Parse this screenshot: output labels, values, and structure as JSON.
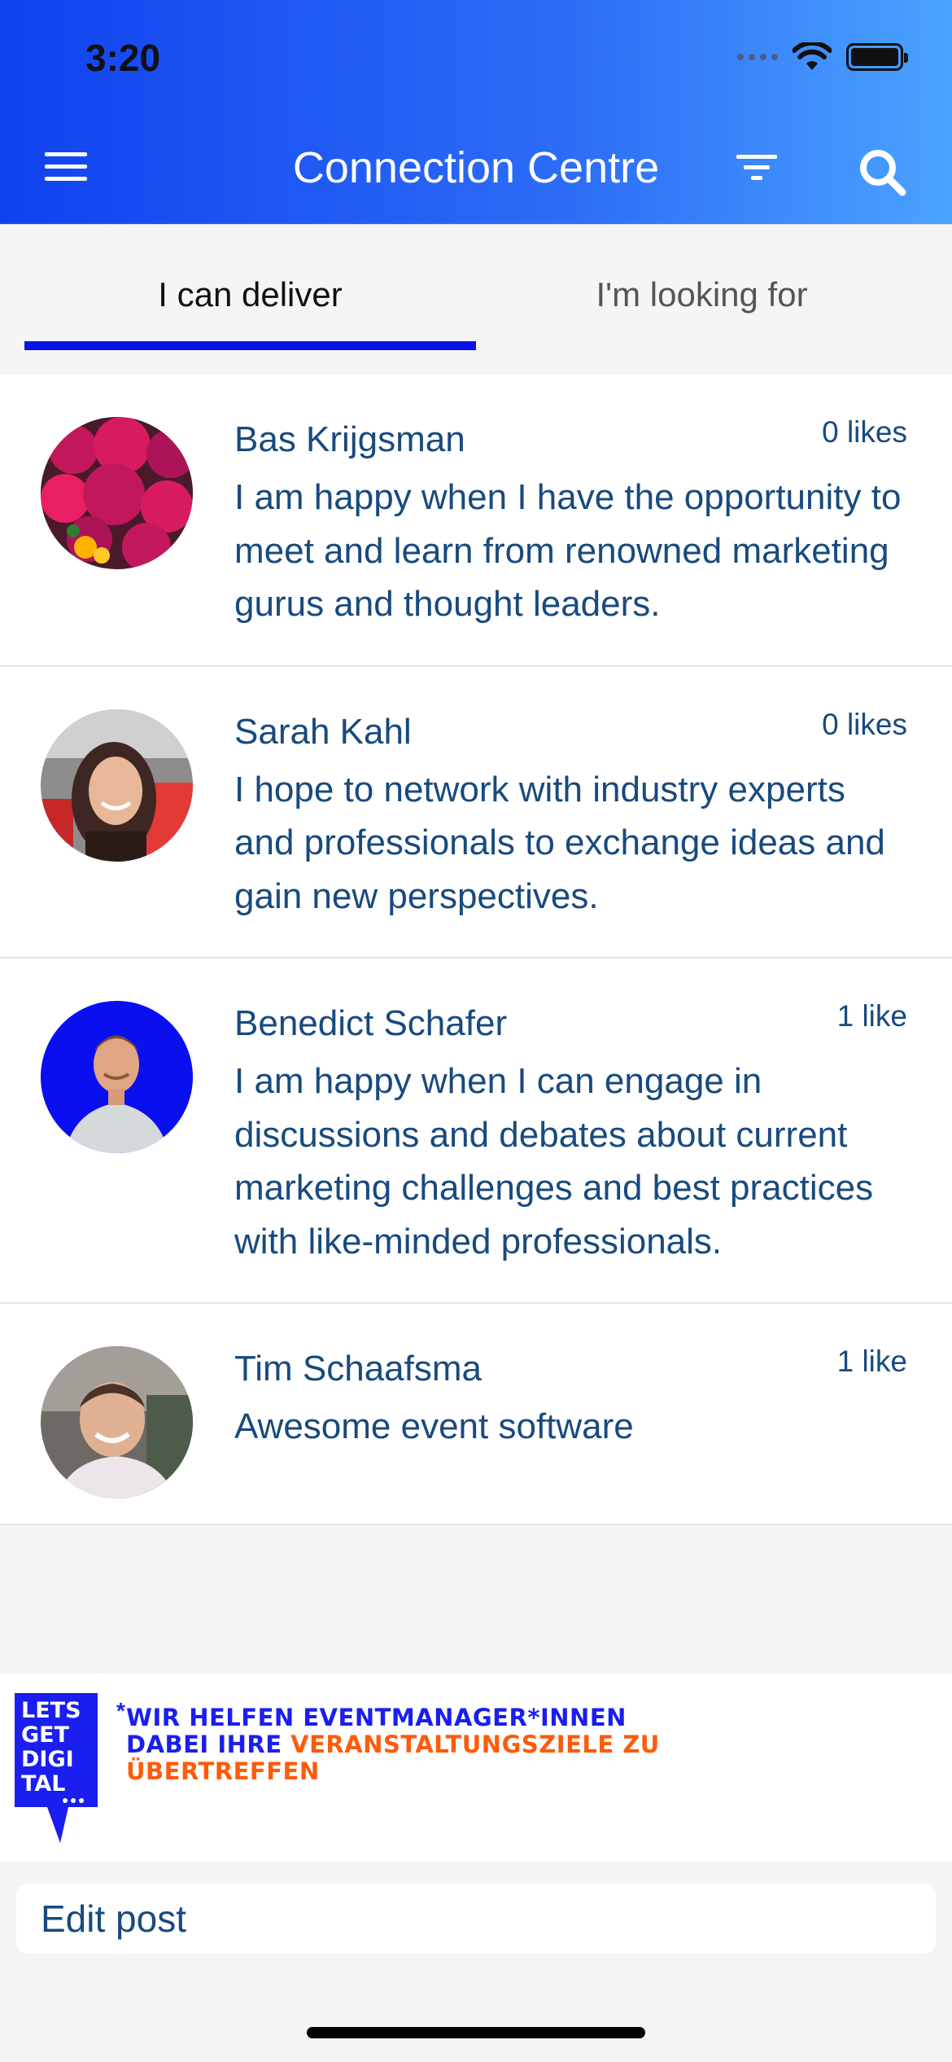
{
  "status_bar": {
    "time": "3:20"
  },
  "header": {
    "title": "Connection Centre"
  },
  "tabs": [
    {
      "label": "I can deliver"
    },
    {
      "label": "I'm looking for"
    }
  ],
  "posts": [
    {
      "name": "Bas Krijgsman",
      "likes": "0 likes",
      "text": "I am happy when I have the opportunity to meet and learn from renowned marketing gurus and thought leaders."
    },
    {
      "name": "Sarah Kahl",
      "likes": "0 likes",
      "text": "I hope to network with industry experts and professionals to exchange ideas and gain new perspectives."
    },
    {
      "name": "Benedict Schafer",
      "likes": "1 like",
      "text": "I am happy when I can engage in discussions and debates about current marketing challenges and best practices with like-minded professionals."
    },
    {
      "name": "Tim Schaafsma",
      "likes": "1 like",
      "text": "Awesome event software"
    }
  ],
  "banner": {
    "logo_text": [
      "LETS",
      "GET",
      "DIGI",
      "TAL"
    ],
    "asterisk": "*",
    "line1": "Wir helfen Eventmanager*innen",
    "line2_blue": "dabei ihre",
    "line2_orange": "Veranstaltungsziele zu",
    "line3_orange": "übertreffen"
  },
  "footer": {
    "edit_label": "Edit post"
  },
  "colors": {
    "accent": "#0a14e6",
    "text": "#184a7e",
    "banner_blue": "#1a1ef0",
    "banner_orange": "#ff5a0a"
  }
}
